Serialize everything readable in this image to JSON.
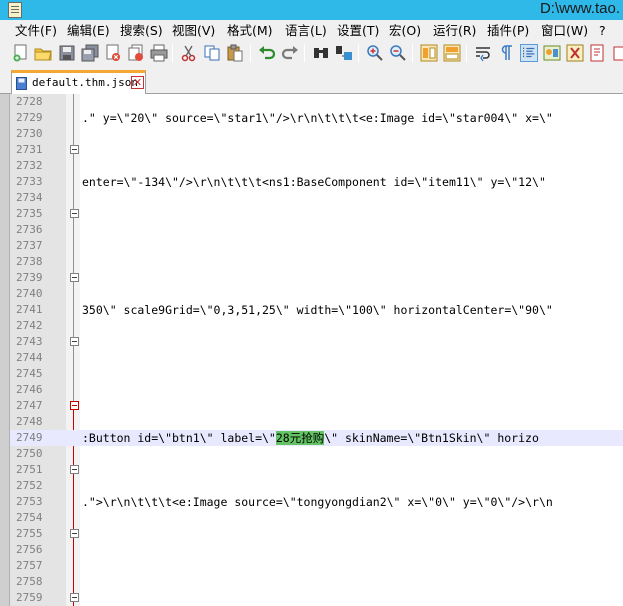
{
  "window": {
    "title": "D:\\www.tao."
  },
  "menu": [
    "文件(F)",
    "编辑(E)",
    "搜索(S)",
    "视图(V)",
    "格式(M)",
    "语言(L)",
    "设置(T)",
    "宏(O)",
    "运行(R)",
    "插件(P)",
    "窗口(W)",
    "?"
  ],
  "tab": {
    "label": "default.thm.json",
    "close": "✕"
  },
  "editor": {
    "line_numbers": [
      "2728",
      "2729",
      "2730",
      "2731",
      "2732",
      "2733",
      "2734",
      "2735",
      "2736",
      "2737",
      "2738",
      "2739",
      "2740",
      "2741",
      "2742",
      "2743",
      "2744",
      "2745",
      "2746",
      "2747",
      "2748",
      "2749",
      "2750",
      "2751",
      "2752",
      "2753",
      "2754",
      "2755",
      "2756",
      "2757",
      "2758",
      "2759"
    ],
    "lines": {
      "l2729": ".\" y=\\\"20\\\" source=\\\"star1\\\"/>\\r\\n\\t\\t\\t<e:Image id=\\\"star004\\\" x=\\\"",
      "l2733": "enter=\\\"-134\\\"/>\\r\\n\\t\\t\\t<ns1:BaseComponent id=\\\"item11\\\" y=\\\"12\\\"",
      "l2741": "350\\\" scale9Grid=\\\"0,3,51,25\\\" width=\\\"100\\\" horizontalCenter=\\\"90\\\"",
      "l2749_pre": ":Button id=\\\"btn1\\\" label=\\\"",
      "l2749_hl": "28元抢购",
      "l2749_post": "\\\" skinName=\\\"Btn1Skin\\\" horizo",
      "l2753": ".\">\\r\\n\\t\\t\\t<e:Image source=\\\"tongyongdian2\\\" x=\\\"0\\\" y=\\\"0\\\"/>\\r\\n"
    }
  },
  "colors": {
    "titlebar": "#2fb9e9",
    "tab_accent": "#f4a732",
    "highlight_word": "#63c463",
    "current_line": "#e8e8ff"
  }
}
